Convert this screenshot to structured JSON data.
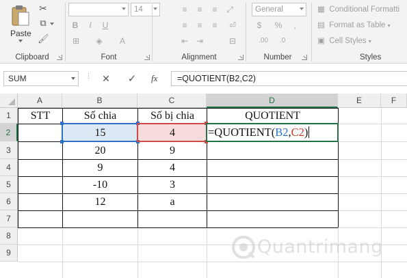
{
  "ribbon": {
    "clipboard": {
      "paste_label": "Paste",
      "group_label": "Clipboard"
    },
    "font": {
      "size_value": "14",
      "group_label": "Font"
    },
    "alignment": {
      "group_label": "Alignment"
    },
    "number": {
      "format_value": "General",
      "group_label": "Number"
    },
    "styles": {
      "conditional_label": "Conditional Formatti",
      "format_table_label": "Format as Table",
      "cell_styles_label": "Cell Styles",
      "group_label": "Styles"
    }
  },
  "formula_bar": {
    "name_box": "SUM",
    "cancel_icon": "✕",
    "enter_icon": "✓",
    "fx_label": "fx",
    "formula": "=QUOTIENT(B2,C2)"
  },
  "grid": {
    "columns": [
      "A",
      "B",
      "C",
      "D",
      "E",
      "F"
    ],
    "selected_column": "D",
    "rows": [
      "1",
      "2",
      "3",
      "4",
      "5",
      "6",
      "7",
      "8",
      "9"
    ],
    "selected_row": "2",
    "headers": {
      "stt": "STT",
      "divisor": "Số chia",
      "dividend": "Số bị chia",
      "result": "QUOTIENT"
    },
    "data": [
      {
        "b": "15",
        "c": "4"
      },
      {
        "b": "20",
        "c": "9"
      },
      {
        "b": "9",
        "c": "4"
      },
      {
        "b": "-10",
        "c": "3"
      },
      {
        "b": "12",
        "c": "a"
      }
    ],
    "editing_formula": {
      "prefix": "=QUOTIENT(",
      "ref1": "B2",
      "comma": ",",
      "ref2": "C2",
      "suffix": ")"
    },
    "ref_colors": {
      "ref1": "#2e6fc7",
      "ref2": "#c0392b",
      "active": "#217346"
    }
  },
  "watermark": {
    "text": "Quantrimang"
  }
}
